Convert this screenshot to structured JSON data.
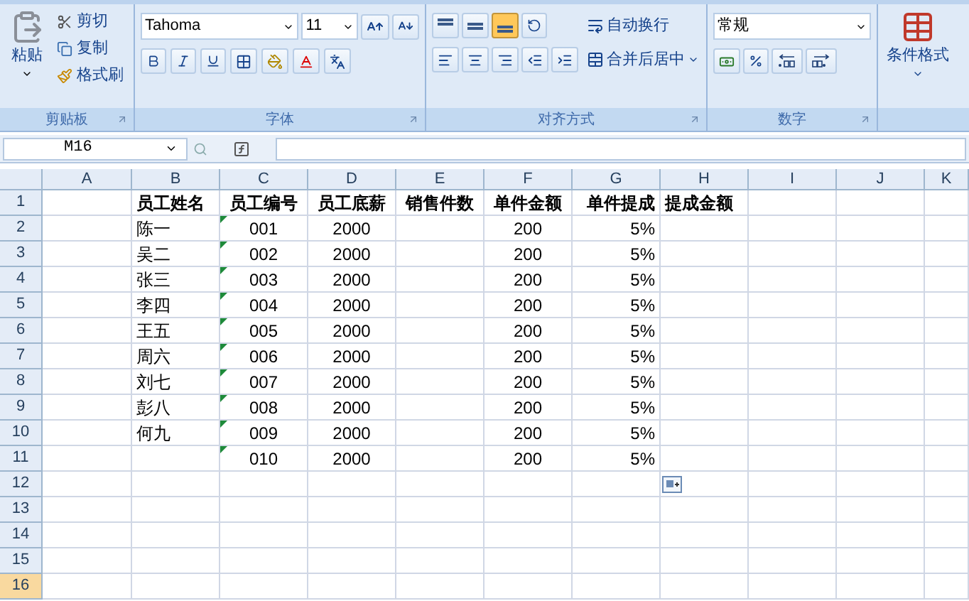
{
  "ribbon": {
    "groups": [
      {
        "kind": "clipboard",
        "label": "剪贴板",
        "paste": "粘贴",
        "items": [
          {
            "kind": "cut",
            "label": "剪切"
          },
          {
            "kind": "copy",
            "label": "复制"
          },
          {
            "kind": "painter",
            "label": "格式刷"
          }
        ]
      },
      {
        "kind": "font",
        "label": "字体",
        "font": "Tahoma",
        "size": "11"
      },
      {
        "kind": "align",
        "label": "对齐方式",
        "vertical": [
          {
            "kind": "top",
            "selected": false
          },
          {
            "kind": "middle",
            "selected": false
          },
          {
            "kind": "bottom",
            "selected": true
          }
        ],
        "wrap": "自动换行",
        "merge": "合并后居中"
      },
      {
        "kind": "number",
        "label": "数字",
        "format": "常规"
      },
      {
        "kind": "styles",
        "conditional": "条件格式"
      }
    ]
  },
  "formula_bar": {
    "name_box": "M16"
  },
  "sheet": {
    "columns": [
      {
        "label": "A",
        "selected": false
      },
      {
        "label": "B",
        "selected": false
      },
      {
        "label": "C",
        "selected": false
      },
      {
        "label": "D",
        "selected": false
      },
      {
        "label": "E",
        "selected": false
      },
      {
        "label": "F",
        "selected": false
      },
      {
        "label": "G",
        "selected": false
      },
      {
        "label": "H",
        "selected": false
      },
      {
        "label": "I",
        "selected": false
      },
      {
        "label": "J",
        "selected": false
      },
      {
        "label": "K",
        "selected": false
      }
    ],
    "rows": [
      {
        "number": "1",
        "selected": false,
        "cells": [
          null,
          {
            "text": "员工姓名"
          },
          {
            "text": "员工编号",
            "flagged": false
          },
          {
            "text": "员工底薪"
          },
          {
            "text": "销售件数"
          },
          {
            "text": "单件金额"
          },
          {
            "text": "单件提成"
          },
          {
            "text": "提成金额"
          },
          null,
          null,
          null
        ]
      },
      {
        "number": "2",
        "selected": false,
        "cells": [
          null,
          {
            "text": "陈一"
          },
          {
            "text": "001",
            "flagged": true
          },
          {
            "text": "2000"
          },
          null,
          {
            "text": "200"
          },
          {
            "text": "5%"
          },
          null,
          null,
          null,
          null
        ]
      },
      {
        "number": "3",
        "selected": false,
        "cells": [
          null,
          {
            "text": "吴二"
          },
          {
            "text": "002",
            "flagged": true
          },
          {
            "text": "2000"
          },
          null,
          {
            "text": "200"
          },
          {
            "text": "5%"
          },
          null,
          null,
          null,
          null
        ]
      },
      {
        "number": "4",
        "selected": false,
        "cells": [
          null,
          {
            "text": "张三"
          },
          {
            "text": "003",
            "flagged": true
          },
          {
            "text": "2000"
          },
          null,
          {
            "text": "200"
          },
          {
            "text": "5%"
          },
          null,
          null,
          null,
          null
        ]
      },
      {
        "number": "5",
        "selected": false,
        "cells": [
          null,
          {
            "text": "李四"
          },
          {
            "text": "004",
            "flagged": true
          },
          {
            "text": "2000"
          },
          null,
          {
            "text": "200"
          },
          {
            "text": "5%"
          },
          null,
          null,
          null,
          null
        ]
      },
      {
        "number": "6",
        "selected": false,
        "cells": [
          null,
          {
            "text": "王五"
          },
          {
            "text": "005",
            "flagged": true
          },
          {
            "text": "2000"
          },
          null,
          {
            "text": "200"
          },
          {
            "text": "5%"
          },
          null,
          null,
          null,
          null
        ]
      },
      {
        "number": "7",
        "selected": false,
        "cells": [
          null,
          {
            "text": "周六"
          },
          {
            "text": "006",
            "flagged": true
          },
          {
            "text": "2000"
          },
          null,
          {
            "text": "200"
          },
          {
            "text": "5%"
          },
          null,
          null,
          null,
          null
        ]
      },
      {
        "number": "8",
        "selected": false,
        "cells": [
          null,
          {
            "text": "刘七"
          },
          {
            "text": "007",
            "flagged": true
          },
          {
            "text": "2000"
          },
          null,
          {
            "text": "200"
          },
          {
            "text": "5%"
          },
          null,
          null,
          null,
          null
        ]
      },
      {
        "number": "9",
        "selected": false,
        "cells": [
          null,
          {
            "text": "彭八"
          },
          {
            "text": "008",
            "flagged": true
          },
          {
            "text": "2000"
          },
          null,
          {
            "text": "200"
          },
          {
            "text": "5%"
          },
          null,
          null,
          null,
          null
        ]
      },
      {
        "number": "10",
        "selected": false,
        "cells": [
          null,
          {
            "text": "何九"
          },
          {
            "text": "009",
            "flagged": true
          },
          {
            "text": "2000"
          },
          null,
          {
            "text": "200"
          },
          {
            "text": "5%"
          },
          null,
          null,
          null,
          null
        ]
      },
      {
        "number": "11",
        "selected": false,
        "cells": [
          null,
          null,
          {
            "text": "010",
            "flagged": true
          },
          {
            "text": "2000"
          },
          null,
          {
            "text": "200"
          },
          {
            "text": "5%"
          },
          null,
          null,
          null,
          null
        ]
      },
      {
        "number": "12",
        "selected": false,
        "cells": []
      },
      {
        "number": "13",
        "selected": false,
        "cells": []
      },
      {
        "number": "14",
        "selected": false,
        "cells": []
      },
      {
        "number": "15",
        "selected": false,
        "cells": []
      },
      {
        "number": "16",
        "selected": true,
        "cells": []
      }
    ]
  }
}
